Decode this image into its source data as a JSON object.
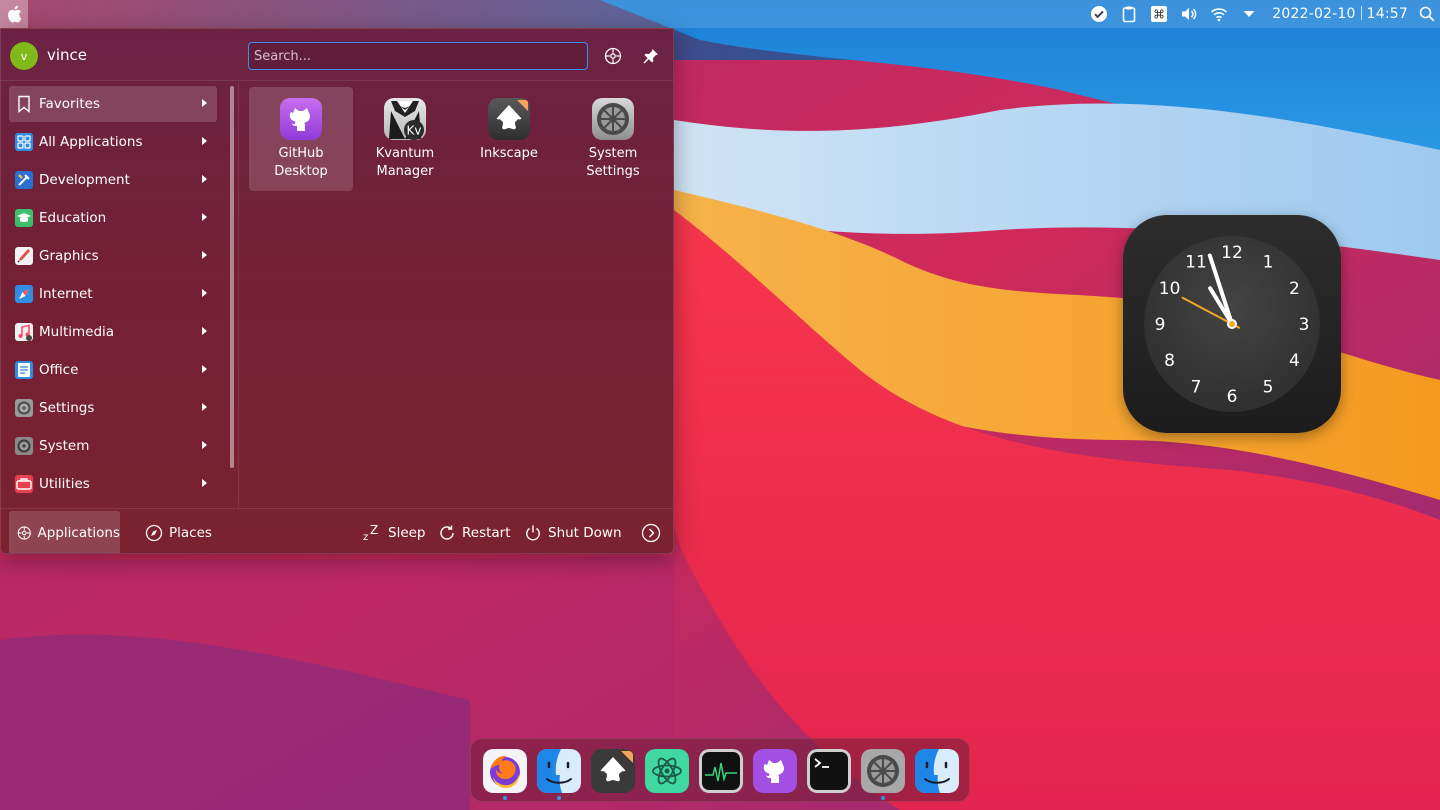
{
  "topbar": {
    "apple_icon": "apple-icon",
    "tray_icons": [
      "check-circle-icon",
      "clipboard-icon",
      "command-key-icon",
      "volume-icon",
      "wifi-icon",
      "tray-expand-icon"
    ],
    "date": "2022-02-10",
    "time": "14:57",
    "search_icon": "search-icon"
  },
  "launcher": {
    "user": {
      "initial": "v",
      "name": "vince"
    },
    "search": {
      "placeholder": "Search...",
      "value": ""
    },
    "categories": [
      {
        "label": "Favorites",
        "icon": "bookmark-icon",
        "active": true
      },
      {
        "label": "All Applications",
        "icon": "grid-icon"
      },
      {
        "label": "Development",
        "icon": "development-icon"
      },
      {
        "label": "Education",
        "icon": "education-icon"
      },
      {
        "label": "Graphics",
        "icon": "graphics-icon"
      },
      {
        "label": "Internet",
        "icon": "internet-icon"
      },
      {
        "label": "Multimedia",
        "icon": "multimedia-icon"
      },
      {
        "label": "Office",
        "icon": "office-icon"
      },
      {
        "label": "Settings",
        "icon": "settings-icon"
      },
      {
        "label": "System",
        "icon": "system-icon"
      },
      {
        "label": "Utilities",
        "icon": "utilities-icon"
      }
    ],
    "apps": [
      {
        "label": "GitHub Desktop",
        "icon": "github-desktop-icon",
        "selected": true
      },
      {
        "label": "Kvantum Manager",
        "icon": "kvantum-icon",
        "badge": "Kv"
      },
      {
        "label": "Inkscape",
        "icon": "inkscape-icon"
      },
      {
        "label": "System Settings",
        "icon": "system-settings-icon"
      }
    ],
    "footer": {
      "tabs": [
        {
          "label": "Applications",
          "icon": "applications-icon",
          "active": true
        },
        {
          "label": "Places",
          "icon": "compass-icon"
        }
      ],
      "actions": [
        {
          "label": "Sleep",
          "icon": "sleep-icon"
        },
        {
          "label": "Restart",
          "icon": "restart-icon"
        },
        {
          "label": "Shut Down",
          "icon": "power-icon"
        }
      ],
      "more_icon": "chevron-right-circle-icon"
    }
  },
  "clock_widget": {
    "numbers": [
      "12",
      "1",
      "2",
      "3",
      "4",
      "5",
      "6",
      "7",
      "8",
      "9",
      "10",
      "11"
    ],
    "time": "10:57",
    "hand_colors": {
      "hours": "#ffffff",
      "minutes": "#ffffff",
      "seconds": "#f5a623"
    }
  },
  "dock": {
    "items": [
      {
        "name": "firefox",
        "icon": "firefox-icon",
        "running": true
      },
      {
        "name": "finder",
        "icon": "finder-icon",
        "running": true
      },
      {
        "name": "inkscape",
        "icon": "inkscape-icon",
        "running": false
      },
      {
        "name": "atom",
        "icon": "atom-icon",
        "running": false
      },
      {
        "name": "activity-monitor",
        "icon": "activity-monitor-icon",
        "running": false
      },
      {
        "name": "github-desktop",
        "icon": "github-desktop-icon",
        "running": false
      },
      {
        "name": "terminal",
        "icon": "terminal-icon",
        "running": false
      },
      {
        "name": "system-settings",
        "icon": "system-settings-icon",
        "running": true
      },
      {
        "name": "finder",
        "icon": "finder-icon",
        "running": false
      }
    ]
  },
  "colors": {
    "accent": "#3d8ee8",
    "avatar": "#7fba1a",
    "clock_second_hand": "#f5a623"
  }
}
